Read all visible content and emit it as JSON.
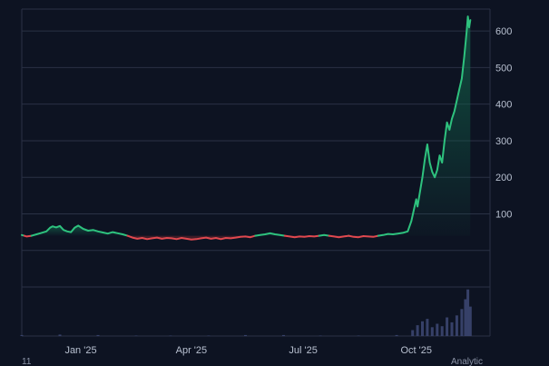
{
  "chart_data": {
    "type": "line",
    "title": "",
    "xlabel": "",
    "ylabel": "",
    "x_ticks": [
      "Jan '25",
      "Apr '25",
      "Jul '25",
      "Oct '25"
    ],
    "x_tick_dates": [
      "2025-01-01",
      "2025-04-01",
      "2025-07-01",
      "2025-10-01"
    ],
    "x_range": [
      "2024-11-14",
      "2025-11-30"
    ],
    "y_ticks": [
      100,
      200,
      300,
      400,
      500,
      600
    ],
    "y_range": [
      -100,
      660
    ],
    "grid": true,
    "baseline_value": 40,
    "colors": {
      "background": "#0d1322",
      "grid": "#2a3145",
      "up": "#2ec27e",
      "down": "#e0484f",
      "up_fill": "#12634a",
      "down_fill": "#7a2a30",
      "volume": "#3b4670"
    },
    "series": [
      {
        "points": [
          [
            "2024-11-14",
            42
          ],
          [
            "2024-11-18",
            38
          ],
          [
            "2024-11-22",
            40
          ],
          [
            "2024-11-26",
            44
          ],
          [
            "2024-11-30",
            48
          ],
          [
            "2024-12-04",
            52
          ],
          [
            "2024-12-07",
            62
          ],
          [
            "2024-12-09",
            66
          ],
          [
            "2024-12-12",
            63
          ],
          [
            "2024-12-15",
            67
          ],
          [
            "2024-12-18",
            56
          ],
          [
            "2024-12-21",
            52
          ],
          [
            "2024-12-24",
            50
          ],
          [
            "2024-12-27",
            62
          ],
          [
            "2024-12-30",
            68
          ],
          [
            "2025-01-03",
            59
          ],
          [
            "2025-01-07",
            54
          ],
          [
            "2025-01-11",
            56
          ],
          [
            "2025-01-15",
            52
          ],
          [
            "2025-01-19",
            49
          ],
          [
            "2025-01-23",
            46
          ],
          [
            "2025-01-27",
            50
          ],
          [
            "2025-01-31",
            47
          ],
          [
            "2025-02-04",
            44
          ],
          [
            "2025-02-08",
            40
          ],
          [
            "2025-02-12",
            35
          ],
          [
            "2025-02-16",
            32
          ],
          [
            "2025-02-20",
            34
          ],
          [
            "2025-02-24",
            31
          ],
          [
            "2025-02-28",
            33
          ],
          [
            "2025-03-04",
            35
          ],
          [
            "2025-03-08",
            32
          ],
          [
            "2025-03-12",
            34
          ],
          [
            "2025-03-16",
            33
          ],
          [
            "2025-03-20",
            31
          ],
          [
            "2025-03-24",
            34
          ],
          [
            "2025-03-28",
            32
          ],
          [
            "2025-04-01",
            30
          ],
          [
            "2025-04-05",
            31
          ],
          [
            "2025-04-09",
            33
          ],
          [
            "2025-04-13",
            35
          ],
          [
            "2025-04-17",
            32
          ],
          [
            "2025-04-21",
            34
          ],
          [
            "2025-04-25",
            31
          ],
          [
            "2025-04-29",
            34
          ],
          [
            "2025-05-03",
            33
          ],
          [
            "2025-05-07",
            35
          ],
          [
            "2025-05-11",
            37
          ],
          [
            "2025-05-15",
            38
          ],
          [
            "2025-05-19",
            36
          ],
          [
            "2025-05-23",
            40
          ],
          [
            "2025-05-27",
            42
          ],
          [
            "2025-05-31",
            44
          ],
          [
            "2025-06-04",
            47
          ],
          [
            "2025-06-08",
            44
          ],
          [
            "2025-06-12",
            42
          ],
          [
            "2025-06-16",
            40
          ],
          [
            "2025-06-20",
            38
          ],
          [
            "2025-06-24",
            36
          ],
          [
            "2025-06-28",
            38
          ],
          [
            "2025-07-02",
            37
          ],
          [
            "2025-07-06",
            39
          ],
          [
            "2025-07-10",
            38
          ],
          [
            "2025-07-14",
            40
          ],
          [
            "2025-07-18",
            42
          ],
          [
            "2025-07-22",
            40
          ],
          [
            "2025-07-26",
            38
          ],
          [
            "2025-07-30",
            36
          ],
          [
            "2025-08-03",
            38
          ],
          [
            "2025-08-07",
            40
          ],
          [
            "2025-08-11",
            37
          ],
          [
            "2025-08-15",
            36
          ],
          [
            "2025-08-19",
            39
          ],
          [
            "2025-08-23",
            38
          ],
          [
            "2025-08-27",
            37
          ],
          [
            "2025-08-31",
            40
          ],
          [
            "2025-09-04",
            42
          ],
          [
            "2025-09-08",
            45
          ],
          [
            "2025-09-12",
            44
          ],
          [
            "2025-09-16",
            46
          ],
          [
            "2025-09-20",
            48
          ],
          [
            "2025-09-24",
            52
          ],
          [
            "2025-09-27",
            80
          ],
          [
            "2025-09-29",
            110
          ],
          [
            "2025-10-01",
            140
          ],
          [
            "2025-10-02",
            120
          ],
          [
            "2025-10-04",
            160
          ],
          [
            "2025-10-06",
            200
          ],
          [
            "2025-10-08",
            250
          ],
          [
            "2025-10-10",
            290
          ],
          [
            "2025-10-12",
            240
          ],
          [
            "2025-10-14",
            215
          ],
          [
            "2025-10-16",
            200
          ],
          [
            "2025-10-18",
            220
          ],
          [
            "2025-10-20",
            260
          ],
          [
            "2025-10-22",
            240
          ],
          [
            "2025-10-24",
            300
          ],
          [
            "2025-10-26",
            350
          ],
          [
            "2025-10-28",
            330
          ],
          [
            "2025-10-30",
            360
          ],
          [
            "2025-11-01",
            380
          ],
          [
            "2025-11-03",
            410
          ],
          [
            "2025-11-05",
            440
          ],
          [
            "2025-11-07",
            470
          ],
          [
            "2025-11-09",
            530
          ],
          [
            "2025-11-11",
            600
          ],
          [
            "2025-11-12",
            640
          ],
          [
            "2025-11-13",
            610
          ],
          [
            "2025-11-14",
            630
          ]
        ]
      }
    ],
    "volume": [
      [
        "2024-11-14",
        0.02
      ],
      [
        "2024-12-15",
        0.03
      ],
      [
        "2025-01-15",
        0.02
      ],
      [
        "2025-02-15",
        0.01
      ],
      [
        "2025-03-15",
        0.01
      ],
      [
        "2025-04-15",
        0.01
      ],
      [
        "2025-05-15",
        0.02
      ],
      [
        "2025-06-15",
        0.02
      ],
      [
        "2025-07-15",
        0.01
      ],
      [
        "2025-08-15",
        0.01
      ],
      [
        "2025-09-15",
        0.02
      ],
      [
        "2025-09-28",
        0.12
      ],
      [
        "2025-10-02",
        0.22
      ],
      [
        "2025-10-06",
        0.3
      ],
      [
        "2025-10-10",
        0.35
      ],
      [
        "2025-10-14",
        0.18
      ],
      [
        "2025-10-18",
        0.25
      ],
      [
        "2025-10-22",
        0.2
      ],
      [
        "2025-10-26",
        0.38
      ],
      [
        "2025-10-30",
        0.28
      ],
      [
        "2025-11-03",
        0.42
      ],
      [
        "2025-11-07",
        0.55
      ],
      [
        "2025-11-10",
        0.75
      ],
      [
        "2025-11-12",
        0.95
      ],
      [
        "2025-11-14",
        0.6
      ]
    ],
    "footer_left": "11",
    "footer_right": "Analytic"
  }
}
